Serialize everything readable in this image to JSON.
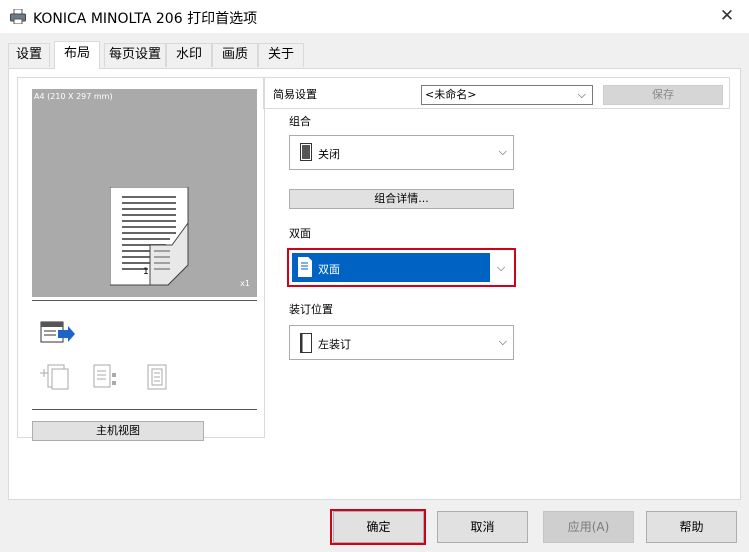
{
  "window": {
    "title": "KONICA MINOLTA 206 打印首选项",
    "close_glyph": "✕"
  },
  "tabs": [
    {
      "label": "设置",
      "active": false
    },
    {
      "label": "布局",
      "active": true
    },
    {
      "label": "每页设置",
      "active": false
    },
    {
      "label": "水印",
      "active": false
    },
    {
      "label": "画质",
      "active": false
    },
    {
      "label": "关于",
      "active": false
    }
  ],
  "preview": {
    "paper_label": "A4  (210 X 297 mm)",
    "copies_label": "x1",
    "page_number": "1",
    "host_view_button": "主机视图"
  },
  "quick_settings": {
    "label": "简易设置",
    "selected": "<未命名>",
    "save_button": "保存"
  },
  "combine": {
    "label": "组合",
    "value": "关闭",
    "detail_button": "组合详情..."
  },
  "duplex": {
    "label": "双面",
    "value": "双面"
  },
  "binding": {
    "label": "装订位置",
    "value": "左装订"
  },
  "buttons": {
    "ok": "确定",
    "cancel": "取消",
    "apply": "应用(A)",
    "help": "帮助"
  },
  "colors": {
    "highlight_outline": "#d0021b",
    "selection_blue": "#0063c4"
  }
}
